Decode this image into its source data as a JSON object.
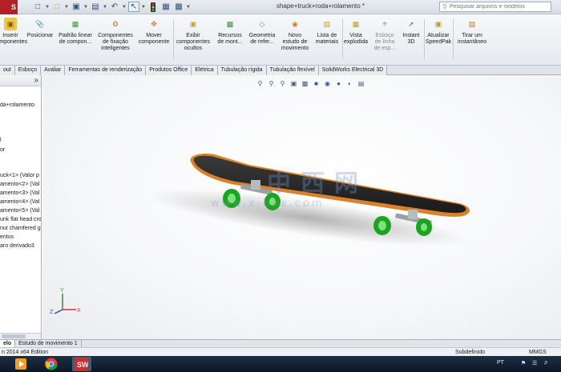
{
  "app": {
    "logo_text": "S",
    "document_title": "shape+truck+roda+rolamento *"
  },
  "quick_access": {
    "new_icon": "new-document-icon",
    "open_icon": "open-folder-icon",
    "save_icon": "save-icon",
    "print_icon": "print-icon",
    "undo_icon": "undo-icon",
    "select_icon": "select-arrow-icon",
    "rebuild_icon": "traffic-light-icon",
    "file_props_icon": "file-properties-icon",
    "options_icon": "options-icon"
  },
  "search": {
    "placeholder": "Pesquisar arquivos e modelos"
  },
  "ribbon": {
    "buttons": [
      {
        "label": "Inserir\ncomponentes",
        "icon": "insert-components-icon"
      },
      {
        "label": "Posicionar",
        "icon": "mate-icon"
      },
      {
        "label": "Padrão linear\nde compon...",
        "icon": "linear-pattern-icon"
      },
      {
        "label": "Componentes\nde fixação\ninteligentes",
        "icon": "smart-fasteners-icon"
      },
      {
        "label": "Mover\ncomponente",
        "icon": "move-component-icon"
      },
      {
        "label": "Exibir\ncomponentes\nocultos",
        "icon": "show-hidden-icon"
      },
      {
        "label": "Recursos\nde mont...",
        "icon": "assembly-features-icon"
      },
      {
        "label": "Geometria\nde refer...",
        "icon": "reference-geometry-icon"
      },
      {
        "label": "Novo\nestudo de\nmovimento",
        "icon": "motion-study-icon"
      },
      {
        "label": "Lista de\nmateriais",
        "icon": "bill-of-materials-icon"
      },
      {
        "label": "Vista\nexplodida",
        "icon": "exploded-view-icon"
      },
      {
        "label": "Esboço\nde linha\nde esp...",
        "icon": "explode-line-sketch-icon"
      },
      {
        "label": "Instant\n3D",
        "icon": "instant-3d-icon"
      },
      {
        "label": "Atualizar\nSpeedPak",
        "icon": "speedpak-icon"
      },
      {
        "label": "Tirar um\ninstantâneo",
        "icon": "snapshot-icon"
      }
    ]
  },
  "tabs": [
    "out",
    "Esboço",
    "Avaliar",
    "Ferramentas de renderização",
    "Produtos Office",
    "Elétrica",
    "Tubulação rígida",
    "Tubulação flexível",
    "SolidWorks Electrical 3D"
  ],
  "feature_tree": {
    "expand_icon": "double-chevron-right-icon",
    "items": [
      "da+rolamento",
      "l",
      "or",
      "",
      "uck<1> (Valor p",
      "amento<2> (Val",
      "amento<3> (Val",
      "amento<4> (Val",
      "amento<5> (Val",
      "unk flat head cro",
      "nut chamfered g",
      "entos",
      "aro derivado3"
    ]
  },
  "viewport": {
    "hud_icons": [
      "zoom-to-fit-icon",
      "zoom-area-icon",
      "previous-view-icon",
      "section-view-icon",
      "view-orientation-icon",
      "display-style-icon",
      "hide-show-icon",
      "appearance-icon",
      "scene-icon",
      "view-settings-icon"
    ],
    "watermark_main": "中西网",
    "watermark_sub": "www.x-box.com",
    "triad": {
      "x": "X",
      "y": "Y",
      "z": "Z"
    }
  },
  "bottom_tabs": [
    "elo",
    "Estudo de movimento 1"
  ],
  "status": {
    "edition": "n 2014 x64 Edition",
    "state": "Subdefinido",
    "units": "MMGS"
  },
  "taskbar": {
    "apps": [
      "media-player-icon",
      "chrome-icon",
      "solidworks-icon"
    ],
    "lang": "PT",
    "tray_icons": [
      "network-icon",
      "volume-icon",
      "flag-icon"
    ]
  },
  "colors": {
    "accent_red": "#b32025",
    "wheel_green": "#2bbf2b",
    "deck_orange": "#d9822b"
  }
}
